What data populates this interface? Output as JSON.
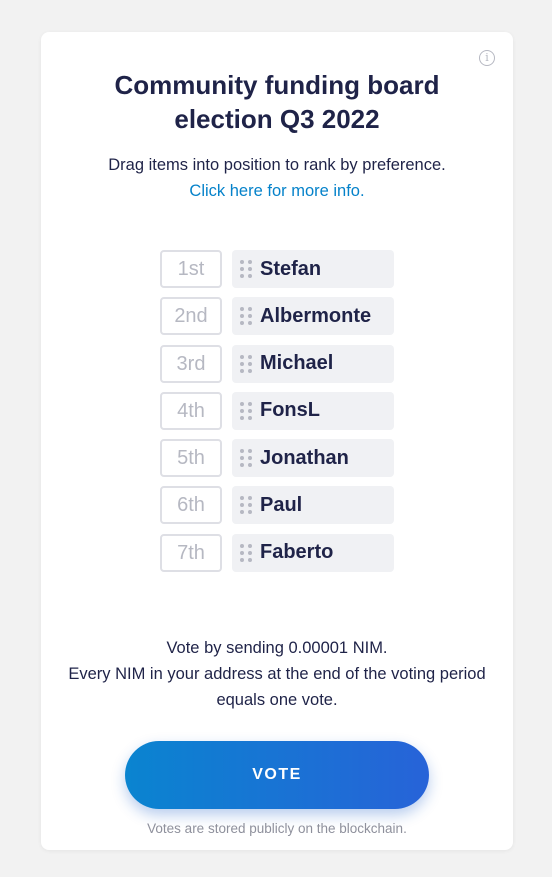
{
  "header": {
    "title": "Community funding board election Q3 2022",
    "info_icon": "info-circle-icon"
  },
  "instructions": {
    "text": "Drag items into position to rank by preference.",
    "link_text": "Click here for more info."
  },
  "ranking": [
    {
      "rank": "1st",
      "name": "Stefan"
    },
    {
      "rank": "2nd",
      "name": "Albermonte"
    },
    {
      "rank": "3rd",
      "name": "Michael"
    },
    {
      "rank": "4th",
      "name": "FonsL"
    },
    {
      "rank": "5th",
      "name": "Jonathan"
    },
    {
      "rank": "6th",
      "name": "Paul"
    },
    {
      "rank": "7th",
      "name": "Faberto"
    }
  ],
  "vote_info": {
    "line1": "Vote by sending 0.00001 NIM.",
    "line2": "Every NIM in your address at the end of the voting period equals one vote."
  },
  "vote_button_label": "VOTE",
  "footer_text": "Votes are stored publicly on the blockchain.",
  "colors": {
    "background": "#f2f2f2",
    "text": "#1f2348",
    "link": "#0582ca",
    "button_gradient_start": "#0a84d0",
    "button_gradient_end": "#2763d8",
    "muted": "#b6b8c2"
  }
}
